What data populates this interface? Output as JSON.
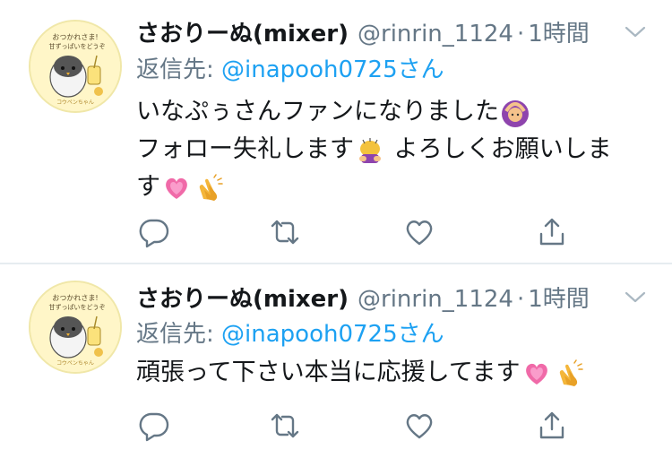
{
  "tweets": [
    {
      "display_name": "さおりーぬ(mixer)",
      "handle": "@rinrin_1124",
      "separator": "·",
      "time": "1時間",
      "reply_prefix": "返信先: ",
      "reply_mention": "@inapooh0725",
      "reply_suffix": "さん",
      "avatar_text": {
        "line1": "おつかれさま!",
        "line2": "甘ずっぱいをどうぞ",
        "brand": "コウペンちゃん"
      },
      "text_lines": [
        "いなぷぅさんファンになりました",
        "フォロー失礼します",
        "よろしくお願いしま",
        "す"
      ],
      "emojis": [
        "woman-gesturing-ok-emoji",
        "woman-bowing-emoji",
        "growing-heart-emoji",
        "clapping-hands-emoji"
      ]
    },
    {
      "display_name": "さおりーぬ(mixer)",
      "handle": "@rinrin_1124",
      "separator": "·",
      "time": "1時間",
      "reply_prefix": "返信先: ",
      "reply_mention": "@inapooh0725",
      "reply_suffix": "さん",
      "avatar_text": {
        "line1": "おつかれさま!",
        "line2": "甘ずっぱいをどうぞ",
        "brand": "コウペンちゃん"
      },
      "text_lines": [
        "頑張って下さい本当に応援してます"
      ],
      "emojis": [
        "growing-heart-emoji",
        "clapping-hands-emoji"
      ]
    }
  ],
  "colors": {
    "text": "#14171a",
    "secondary": "#657786",
    "link": "#1da1f2",
    "divider": "#e6ecf0",
    "avatar_bg": "#fff6c8"
  },
  "icons": [
    "reply-icon",
    "retweet-icon",
    "like-icon",
    "share-icon",
    "chevron-down-icon"
  ]
}
